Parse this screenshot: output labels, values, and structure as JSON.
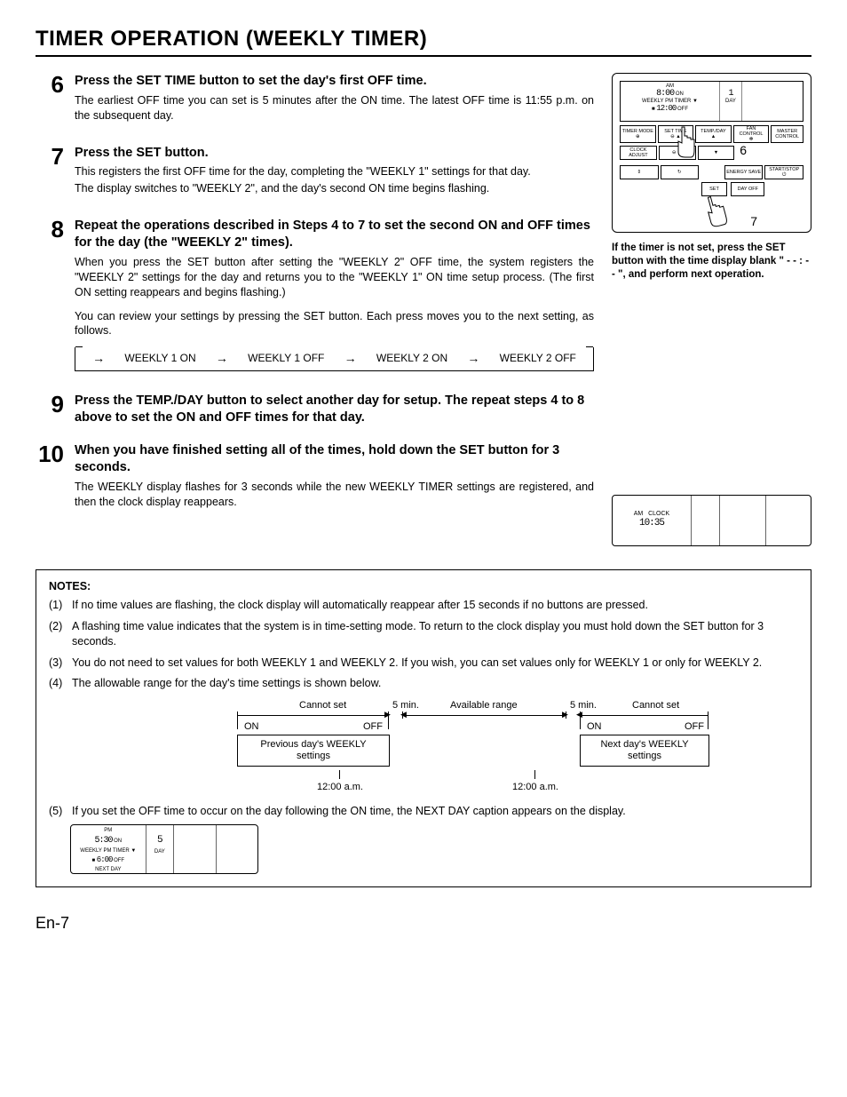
{
  "page": {
    "title": "TIMER OPERATION (WEEKLY TIMER)",
    "footer": "En-7"
  },
  "steps": {
    "s6": {
      "num": "6",
      "title": "Press the SET TIME button to set the day's first OFF time.",
      "body1": "The earliest OFF time you can set is 5 minutes after the ON time. The latest OFF time is 11:55 p.m. on the subsequent day."
    },
    "s7": {
      "num": "7",
      "title": "Press the SET button.",
      "body1": "This registers the first OFF time for the day, completing the \"WEEKLY 1\" settings for that day.",
      "body2": "The display switches to \"WEEKLY 2\", and the day's second ON time begins flashing."
    },
    "s8": {
      "num": "8",
      "title": "Repeat the operations described in Steps 4 to 7 to set the second ON and OFF times for the day (the \"WEEKLY 2\" times).",
      "body1": "When you press the SET button after setting the \"WEEKLY 2\" OFF time, the system registers the \"WEEKLY 2\" settings for the day and returns you to the \"WEEKLY 1\" ON time setup process. (The first ON setting reappears and begins flashing.)",
      "body2": "You can review your settings by pressing the SET button. Each press moves you to the next setting, as follows.",
      "flow": [
        "WEEKLY 1 ON",
        "WEEKLY 1 OFF",
        "WEEKLY 2 ON",
        "WEEKLY 2 OFF"
      ]
    },
    "s9": {
      "num": "9",
      "title": "Press the TEMP./DAY button to select another day for setup. The repeat steps 4 to 8 above to set the ON and OFF times for that day."
    },
    "s10": {
      "num": "10",
      "title": "When you have finished setting all of the times, hold down the SET button for 3 seconds.",
      "body1": "The WEEKLY display flashes for 3 seconds while the new WEEKLY TIMER settings are registered, and then the clock display reappears."
    }
  },
  "remote": {
    "display": {
      "am": "AM",
      "time_on": "8:00",
      "on": "ON",
      "pm": "PM",
      "timer": "TIMER",
      "time_off": "12:00",
      "off": "OFF",
      "weekly": "WEEKLY",
      "day_num": "1",
      "day": "DAY"
    },
    "buttons": {
      "timer_mode": "TIMER MODE",
      "set_time": "SET TIME",
      "temp_day": "TEMP./DAY",
      "fan_control": "FAN CONTROL",
      "master_control": "MASTER CONTROL",
      "clock_adjust": "CLOCK ADJUST",
      "energy_save": "ENERGY SAVE",
      "start_stop": "START/STOP",
      "set": "SET",
      "day_off": "DAY OFF"
    },
    "callout6": "6",
    "callout7": "7",
    "note": "If the timer is not set, press the SET button with the time display blank \" - - : - - \", and perform next operation."
  },
  "clock_lcd": {
    "am": "AM",
    "clock": "CLOCK",
    "time": "10:35"
  },
  "notes": {
    "title": "NOTES:",
    "n1": "If no time values are flashing, the clock display will automatically reappear after 15 seconds if no buttons are pressed.",
    "n2": "A flashing time value indicates that the system is in time-setting mode. To return to the clock display you must hold down the SET button for 3 seconds.",
    "n3": "You do not need to set values for both WEEKLY 1 and WEEKLY 2. If you wish, you can set values only for WEEKLY 1 or only for WEEKLY 2.",
    "n4": "The allowable range for the day's time settings is shown below.",
    "n5": "If you set the OFF time to occur on the day following the ON time, the NEXT DAY caption appears on the display.",
    "range": {
      "cannot_set": "Cannot set",
      "five_min": "5 min.",
      "available": "Available range",
      "on": "ON",
      "off": "OFF",
      "prev": "Previous day's WEEKLY settings",
      "next": "Next day's WEEKLY settings",
      "midnight": "12:00 a.m."
    }
  },
  "mini_lcd": {
    "pm": "PM",
    "time_on": "5:30",
    "on": "ON",
    "pm2": "PM",
    "timer": "TIMER",
    "weekly": "WEEKLY",
    "time_off": "6:00",
    "off": "OFF",
    "next_day": "NEXT DAY",
    "day_num": "5",
    "day": "DAY"
  }
}
